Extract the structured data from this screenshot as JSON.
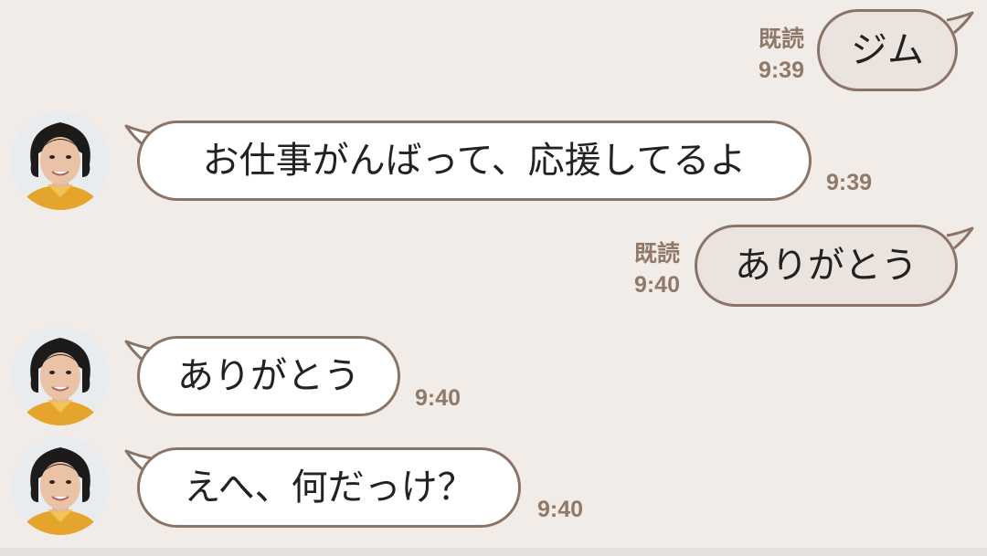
{
  "colors": {
    "background": "#f1ece7",
    "bubble_border": "#8a7468",
    "incoming_bubble": "#ffffff",
    "outgoing_bubble": "#ebe4de",
    "meta_text": "#8f7a69"
  },
  "messages": [
    {
      "direction": "outgoing",
      "text": "ジム",
      "read_label": "既読",
      "time": "9:39"
    },
    {
      "direction": "incoming",
      "text": "お仕事がんばって、応援してるよ",
      "time": "9:39",
      "avatar_icon": "contact-avatar"
    },
    {
      "direction": "outgoing",
      "text": "ありがとう",
      "read_label": "既読",
      "time": "9:40"
    },
    {
      "direction": "incoming",
      "text": "ありがとう",
      "time": "9:40",
      "avatar_icon": "contact-avatar"
    },
    {
      "direction": "incoming",
      "text": "えへ、何だっけ？",
      "time": "9:40",
      "avatar_icon": "contact-avatar"
    }
  ]
}
